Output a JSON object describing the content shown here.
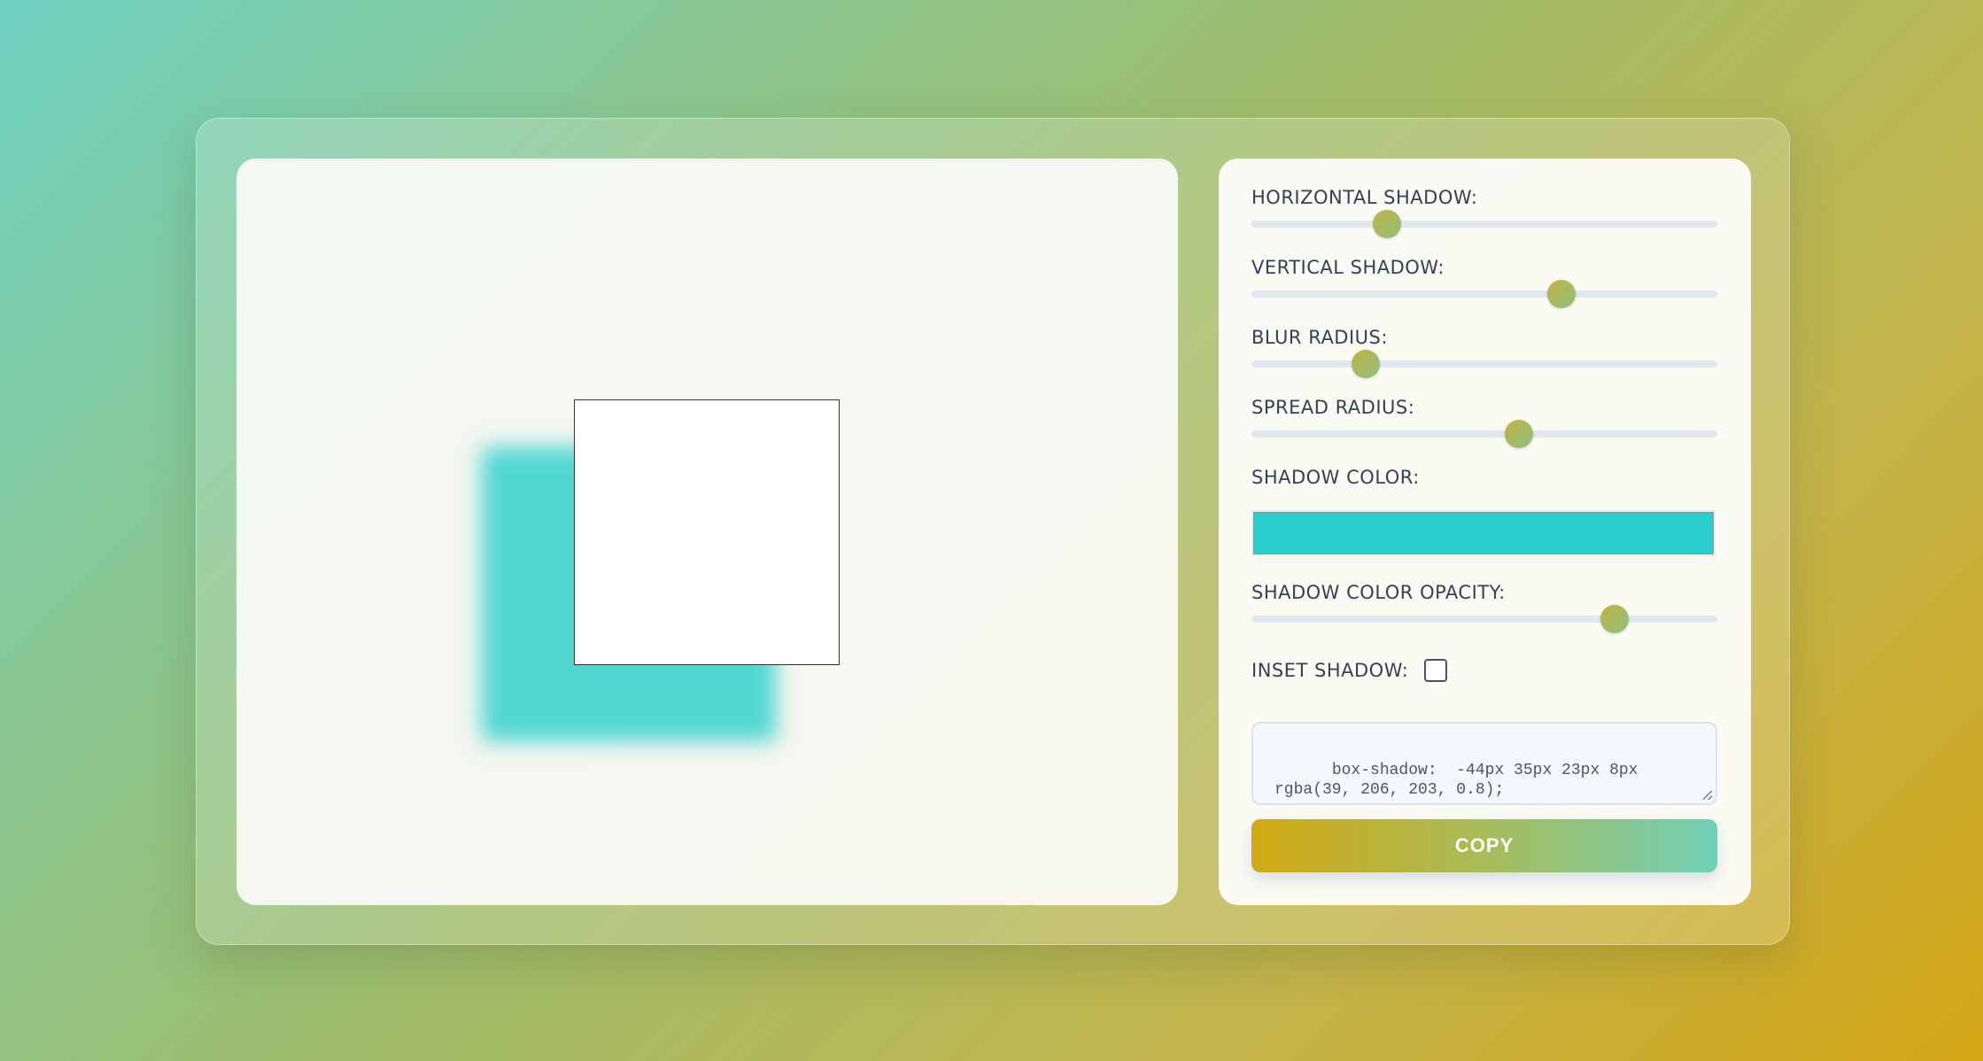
{
  "preview": {
    "shadow_color": "#27cecb"
  },
  "controls": {
    "horizontal_shadow": {
      "label": "HORIZONTAL SHADOW:",
      "value_fraction": 0.29
    },
    "vertical_shadow": {
      "label": "VERTICAL SHADOW:",
      "value_fraction": 0.665
    },
    "blur_radius": {
      "label": "BLUR RADIUS:",
      "value_fraction": 0.245
    },
    "spread_radius": {
      "label": "SPREAD RADIUS:",
      "value_fraction": 0.575
    },
    "shadow_color": {
      "label": "SHADOW COLOR:",
      "value": "#27cecb"
    },
    "shadow_opacity": {
      "label": "SHADOW COLOR OPACITY:",
      "value_fraction": 0.78
    },
    "inset_shadow": {
      "label": "INSET SHADOW:",
      "checked": false
    }
  },
  "output": {
    "code": "box-shadow:  -44px 35px 23px 8px\nrgba(39, 206, 203, 0.8);",
    "copy_label": "COPY"
  }
}
